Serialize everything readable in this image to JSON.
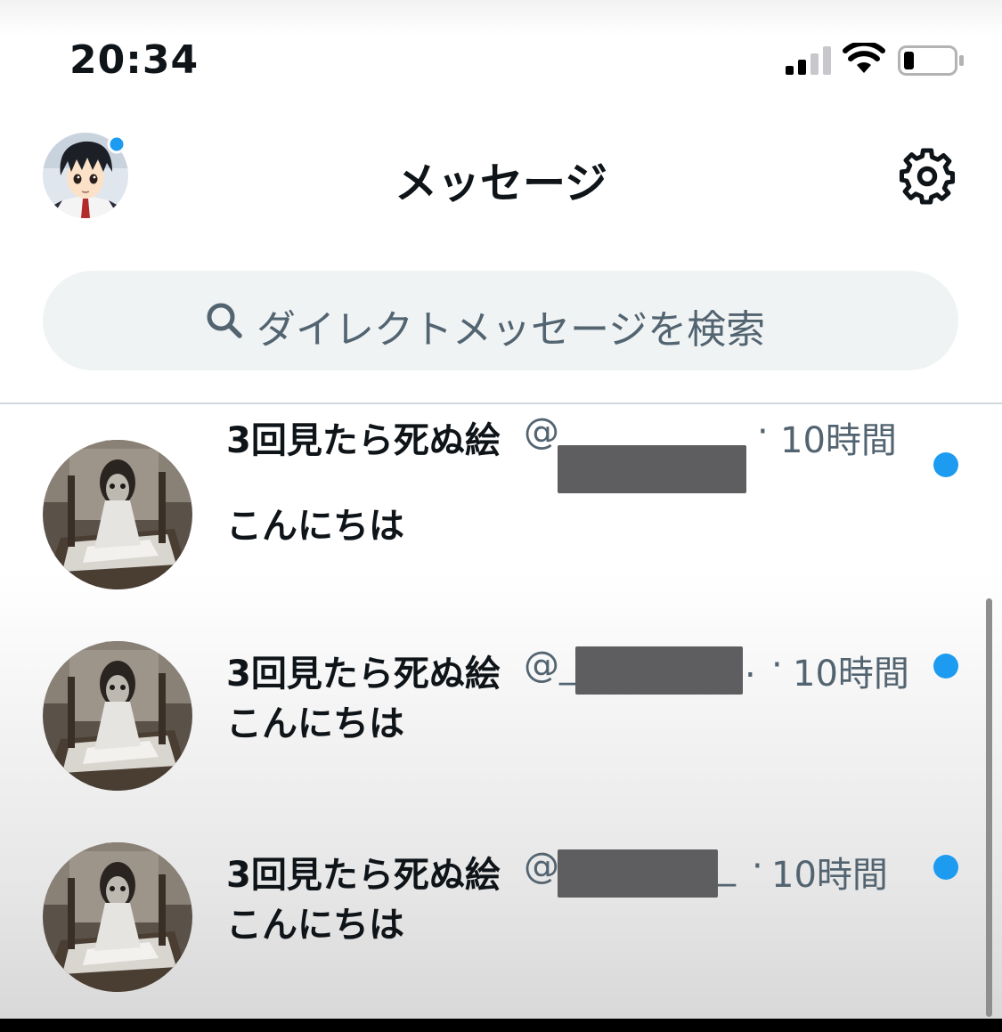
{
  "status_bar": {
    "time": "20:34",
    "signal_icon": "cellular-signal-icon",
    "wifi_icon": "wifi-icon",
    "battery_icon": "battery-low-icon"
  },
  "header": {
    "title": "メッセージ",
    "avatar_icon": "profile-avatar",
    "settings_icon": "gear-icon"
  },
  "search": {
    "placeholder": "ダイレクトメッセージを検索",
    "icon": "search-icon"
  },
  "conversations": [
    {
      "name": "3回見たら死ぬ絵",
      "handle_prefix": "@",
      "handle_suffix": "",
      "separator": "·",
      "time": "10時間",
      "preview": "こんにちは",
      "unread": true
    },
    {
      "name": "3回見たら死ぬ絵",
      "handle_prefix": "@_",
      "handle_suffix": ".",
      "separator": "·",
      "time": "10時間",
      "preview": "こんにちは",
      "unread": true
    },
    {
      "name": "3回見たら死ぬ絵",
      "handle_prefix": "@",
      "handle_suffix": "_",
      "separator": "·",
      "time": "10時間",
      "preview": "こんにちは",
      "unread": true
    }
  ],
  "colors": {
    "accent": "#1d9bf0",
    "text_primary": "#0f1419",
    "text_secondary": "#536471",
    "search_bg": "#eff3f4",
    "divider": "#cfd9de"
  }
}
